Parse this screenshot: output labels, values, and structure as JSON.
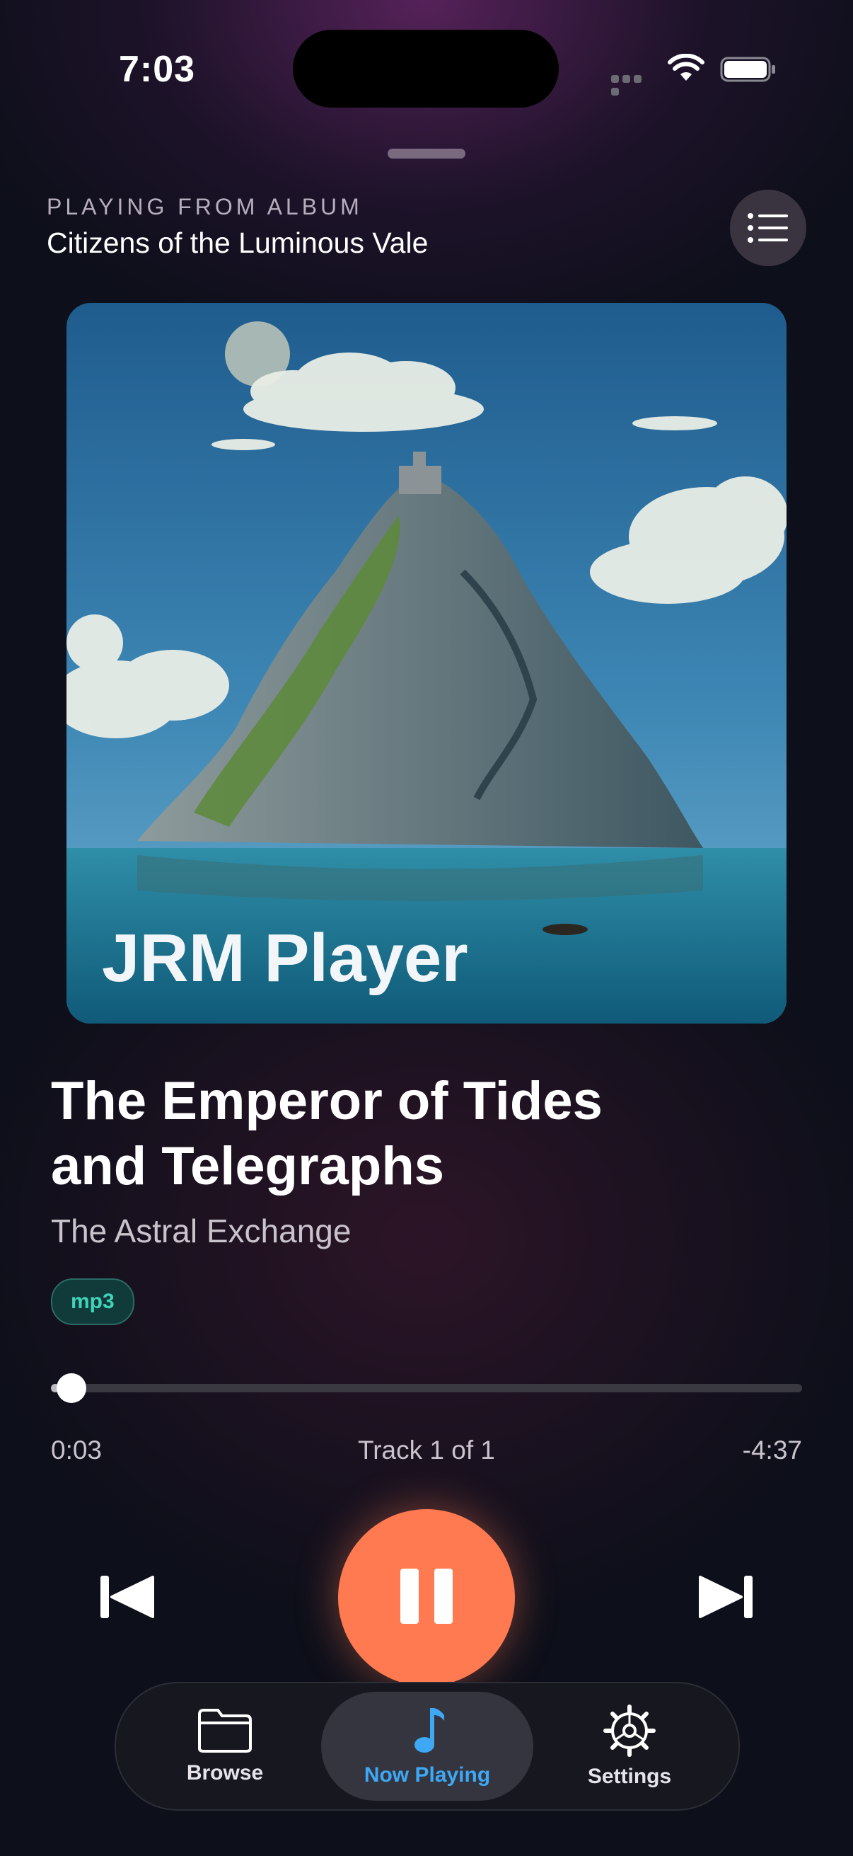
{
  "status_bar": {
    "time": "7:03"
  },
  "header": {
    "context_label": "PLAYING FROM ALBUM",
    "album_name": "Citizens of the Luminous Vale"
  },
  "artwork": {
    "overlay_text": "JRM Player"
  },
  "track": {
    "title": "The Emperor of Tides and Telegraphs",
    "artist": "The Astral Exchange",
    "format_badge": "mp3",
    "elapsed": "0:03",
    "position_text": "Track 1 of 1",
    "remaining": "-4:37",
    "progress_fraction": 0.011
  },
  "controls": {
    "previous_icon": "skip-back-icon",
    "play_pause_icon": "pause-icon",
    "next_icon": "skip-forward-icon"
  },
  "tabs": [
    {
      "label": "Browse",
      "icon": "folder-icon",
      "active": false
    },
    {
      "label": "Now Playing",
      "icon": "music-note-icon",
      "active": true
    },
    {
      "label": "Settings",
      "icon": "gear-icon",
      "active": false
    }
  ],
  "colors": {
    "accent": "#ff7a50",
    "active_tab": "#3ea8f5",
    "badge_text": "#3fd3b8"
  }
}
